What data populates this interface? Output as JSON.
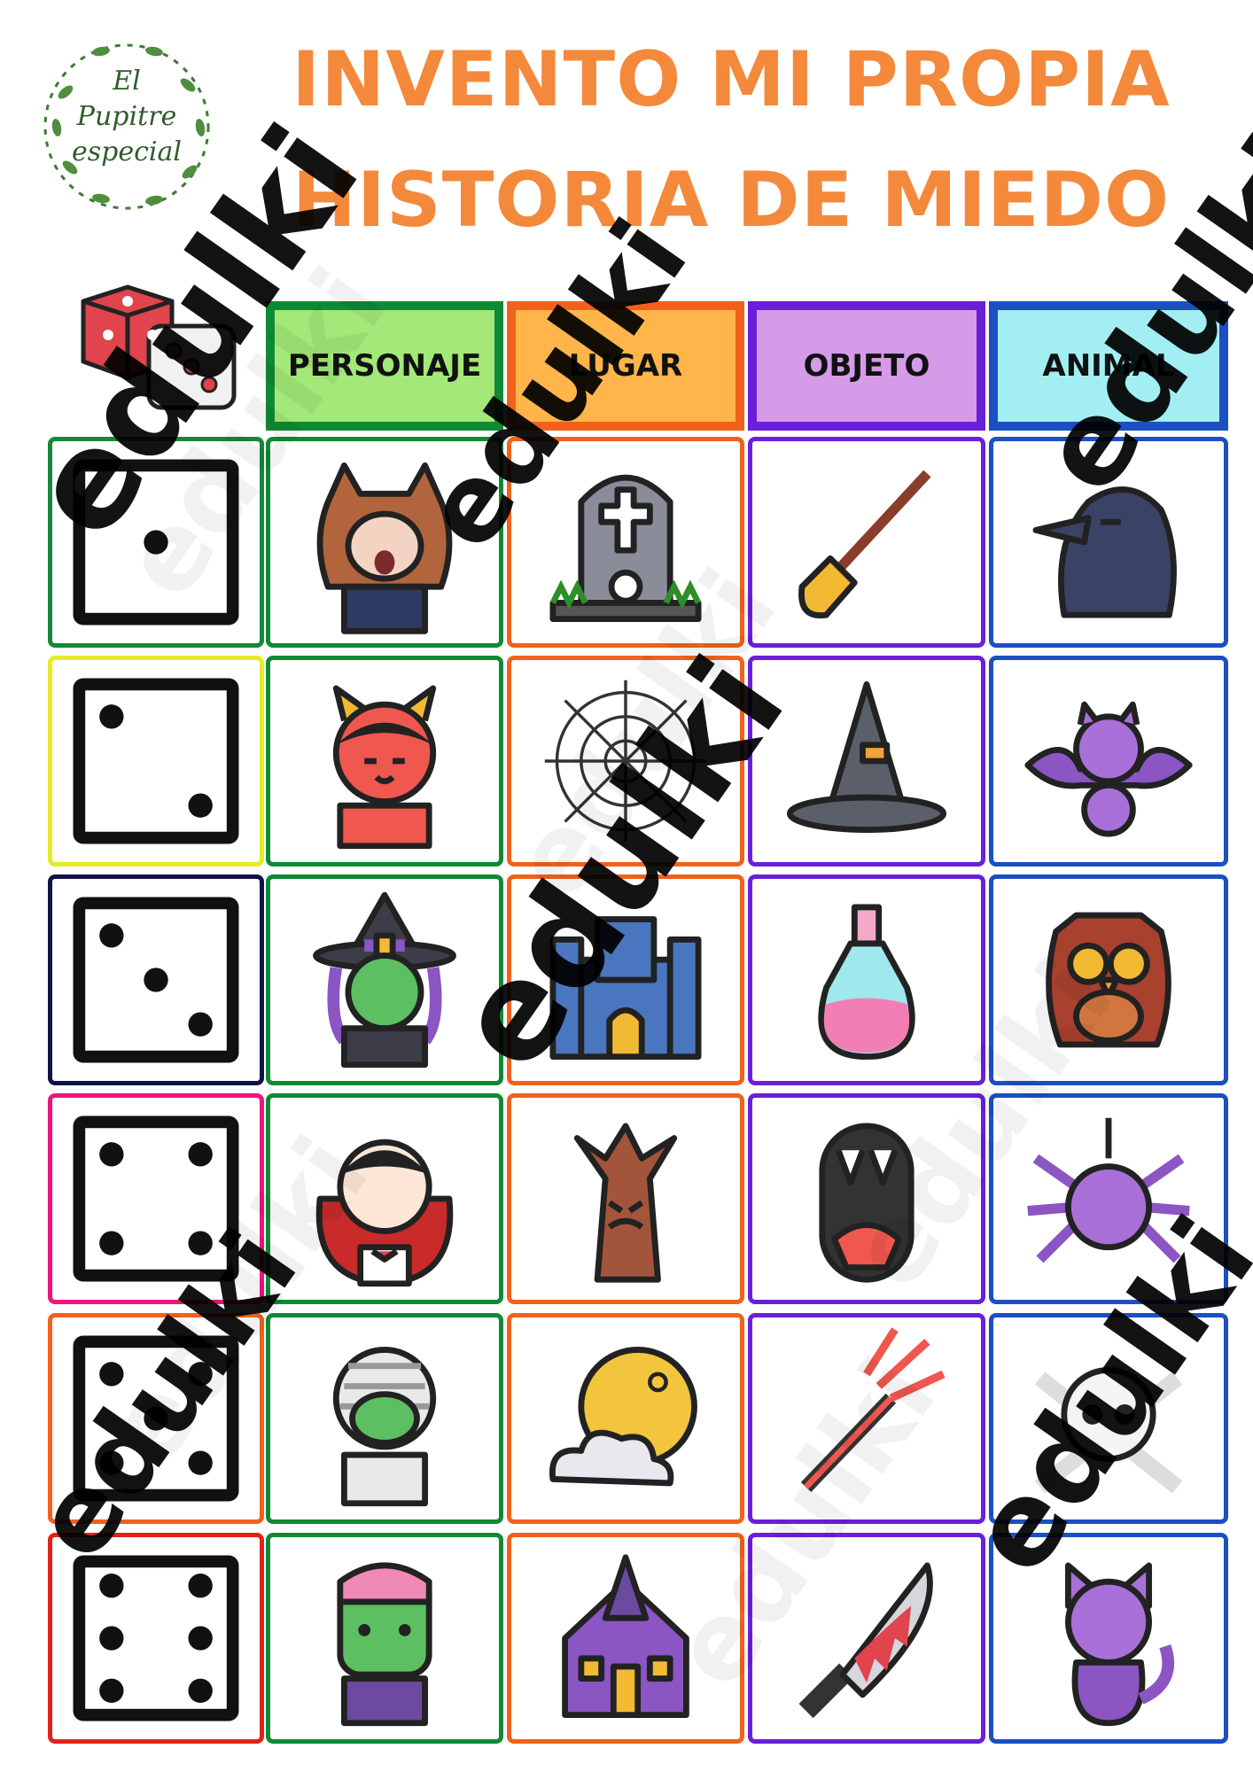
{
  "logo": {
    "line1": "El",
    "line2": "Pupitre",
    "line3": "especial"
  },
  "title": {
    "line1": "INVENTO MI PROPIA",
    "line2": "HISTORIA DE MIEDO"
  },
  "headers": [
    {
      "label": "PERSONAJE",
      "bg": "#a3e878",
      "border": "#0f8a34"
    },
    {
      "label": "LUGAR",
      "bg": "#ffb54a",
      "border": "#f2611c"
    },
    {
      "label": "OBJETO",
      "bg": "#d59ae8",
      "border": "#6a1fd8"
    },
    {
      "label": "ANIMAL",
      "bg": "#a2eef2",
      "border": "#1b4fc2"
    }
  ],
  "rows": [
    {
      "die": 1,
      "die_border": "#16883a",
      "items": [
        "werewolf-icon",
        "tombstone-icon",
        "broom-icon",
        "crow-icon"
      ]
    },
    {
      "die": 2,
      "die_border": "#e5ec26",
      "items": [
        "devil-icon",
        "spiderweb-icon",
        "witch-hat-icon",
        "bat-icon"
      ]
    },
    {
      "die": 3,
      "die_border": "#12124a",
      "items": [
        "witch-icon",
        "castle-icon",
        "potion-icon",
        "owl-icon"
      ]
    },
    {
      "die": 4,
      "die_border": "#f0147c",
      "items": [
        "vampire-icon",
        "haunted-tree-icon",
        "fangs-icon",
        "spider-icon"
      ]
    },
    {
      "die": 5,
      "die_border": "#f2611c",
      "items": [
        "mummy-icon",
        "moon-cloud-icon",
        "trident-icon",
        "skull-crossbones-icon"
      ]
    },
    {
      "die": 6,
      "die_border": "#e1221c",
      "items": [
        "frankenstein-icon",
        "haunted-house-icon",
        "bloody-knife-icon",
        "cat-icon"
      ]
    }
  ],
  "watermark": "edulki"
}
